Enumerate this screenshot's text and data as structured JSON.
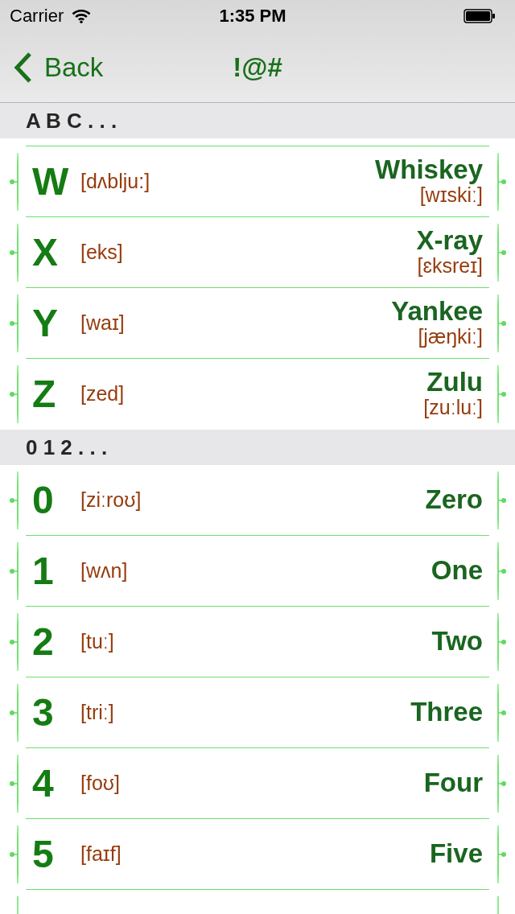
{
  "status_bar": {
    "carrier": "Carrier",
    "time": "1:35 PM"
  },
  "nav_bar": {
    "back_label": "Back",
    "title": "!@#"
  },
  "sections": [
    {
      "header": "A B C . . .",
      "cut_top": true,
      "cut_bottom": false,
      "rows": [
        {
          "symbol": "W",
          "phonetic": "[dʌblju:]",
          "word": "Whiskey",
          "word_phonetic": "[wɪskiː]"
        },
        {
          "symbol": "X",
          "phonetic": "[eks]",
          "word": "X-ray",
          "word_phonetic": "[ɛksreɪ]"
        },
        {
          "symbol": "Y",
          "phonetic": "[waɪ]",
          "word": "Yankee",
          "word_phonetic": "[jæŋkiː]"
        },
        {
          "symbol": "Z",
          "phonetic": "[zed]",
          "word": "Zulu",
          "word_phonetic": "[zuːluː]"
        }
      ]
    },
    {
      "header": "0 1 2 . . .",
      "cut_top": false,
      "cut_bottom": true,
      "rows": [
        {
          "symbol": "0",
          "phonetic": "[ziːroʊ]",
          "word": "Zero"
        },
        {
          "symbol": "1",
          "phonetic": "[wʌn]",
          "word": "One"
        },
        {
          "symbol": "2",
          "phonetic": "[tuː]",
          "word": "Two"
        },
        {
          "symbol": "3",
          "phonetic": "[triː]",
          "word": "Three"
        },
        {
          "symbol": "4",
          "phonetic": "[foʊ]",
          "word": "Four"
        },
        {
          "symbol": "5",
          "phonetic": "[faɪf]",
          "word": "Five"
        }
      ]
    }
  ]
}
